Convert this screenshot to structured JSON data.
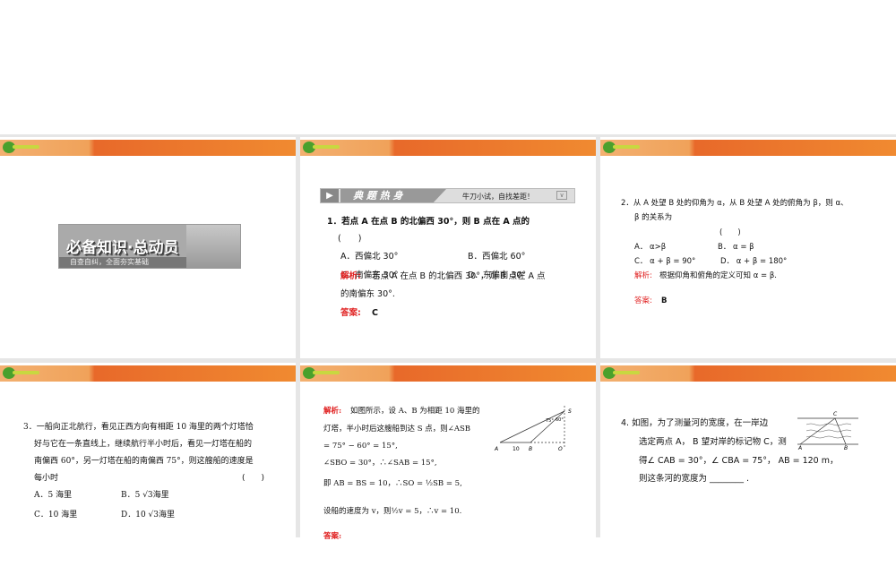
{
  "slides": [
    {
      "banner_title": "必备知识·总动员",
      "banner_subtitle": "自查自纠，全面夯实基础"
    },
    {
      "section_title": "典 题 热 身",
      "section_subtitle": "牛刀小试，自找差距！",
      "q1_line1": "1．若点 A 在点 B 的北偏西 30°，则 B 点在 A 点的",
      "q1_paren": "(　　)",
      "opt_a": "A．西偏北 30°",
      "opt_b": "B．西偏北 60°",
      "opt_c": "C．南偏东 30°",
      "opt_d": "D．东偏南 30°",
      "analysis_label": "解析:",
      "analysis_line1": "若点 A 在点 B 的北偏西 30°，则 B 点在 A 点",
      "analysis_line2": "的南偏东 30°.",
      "answer_label": "答案:",
      "answer": "C"
    },
    {
      "q2_line1": "2．从 A 处望 B 处的仰角为 α，从 B 处望 A 处的俯角为 β，则 α、",
      "q2_line2": "β 的关系为",
      "q2_paren": "(　　)",
      "opt_a": "A．  α>β",
      "opt_b": "B．  α = β",
      "opt_c": "C．  α + β = 90°",
      "opt_d": "D．  α + β = 180°",
      "analysis_label": "解析:",
      "analysis": "根据仰角和俯角的定义可知 α = β.",
      "answer_label": "答案:",
      "answer": "B"
    },
    {
      "q3_line1": "3．一船向正北航行，看见正西方向有相距 10 海里的两个灯塔恰",
      "q3_line2": "好与它在一条直线上，继续航行半小时后，看见一灯塔在船的",
      "q3_line3": "南偏西  60°，另一灯塔在船的南偏西  75°，则这艘船的速度是",
      "q3_line4": "每小时",
      "q3_paren": "(　　)",
      "opt_a": "A．5 海里",
      "opt_b": "B．5 √3海里",
      "opt_c": "C．10 海里",
      "opt_d": "D．10 √3海里"
    },
    {
      "analysis_label": "解析:",
      "l1": "如图所示，设 A、B 为相距 10 海里的",
      "l2": "灯塔，半小时后这艘船到达 S 点，则∠ASB",
      "l3": "= 75° − 60° = 15°,",
      "l4": "∠SBO = 30°，∴∠SAB = 15°,",
      "l5": "即 AB = BS = 10，∴SO = ½SB = 5,",
      "l6": "设船的速度为 v，则½v = 5，∴v = 10.",
      "answer_label": "答案:",
      "fig": {
        "A": "A",
        "B": "B",
        "O": "O",
        "S": "S",
        "dist": "10",
        "ang1": "75°",
        "ang2": "60°"
      }
    },
    {
      "q4_line1": "4. 如图，为了测量河的宽度，在一岸边",
      "q4_line2": "选定两点 A， B 望对岸的标记物 C，测",
      "q4_line3": "得∠ CAB = 30°，∠ CBA = 75°， AB = 120 m，",
      "q4_line4": "则这条河的宽度为 ________ .",
      "fig": {
        "A": "A",
        "B": "B",
        "C": "C"
      }
    }
  ],
  "colors": {
    "header_orange": "#e8692a",
    "accent_red": "#e02020"
  }
}
